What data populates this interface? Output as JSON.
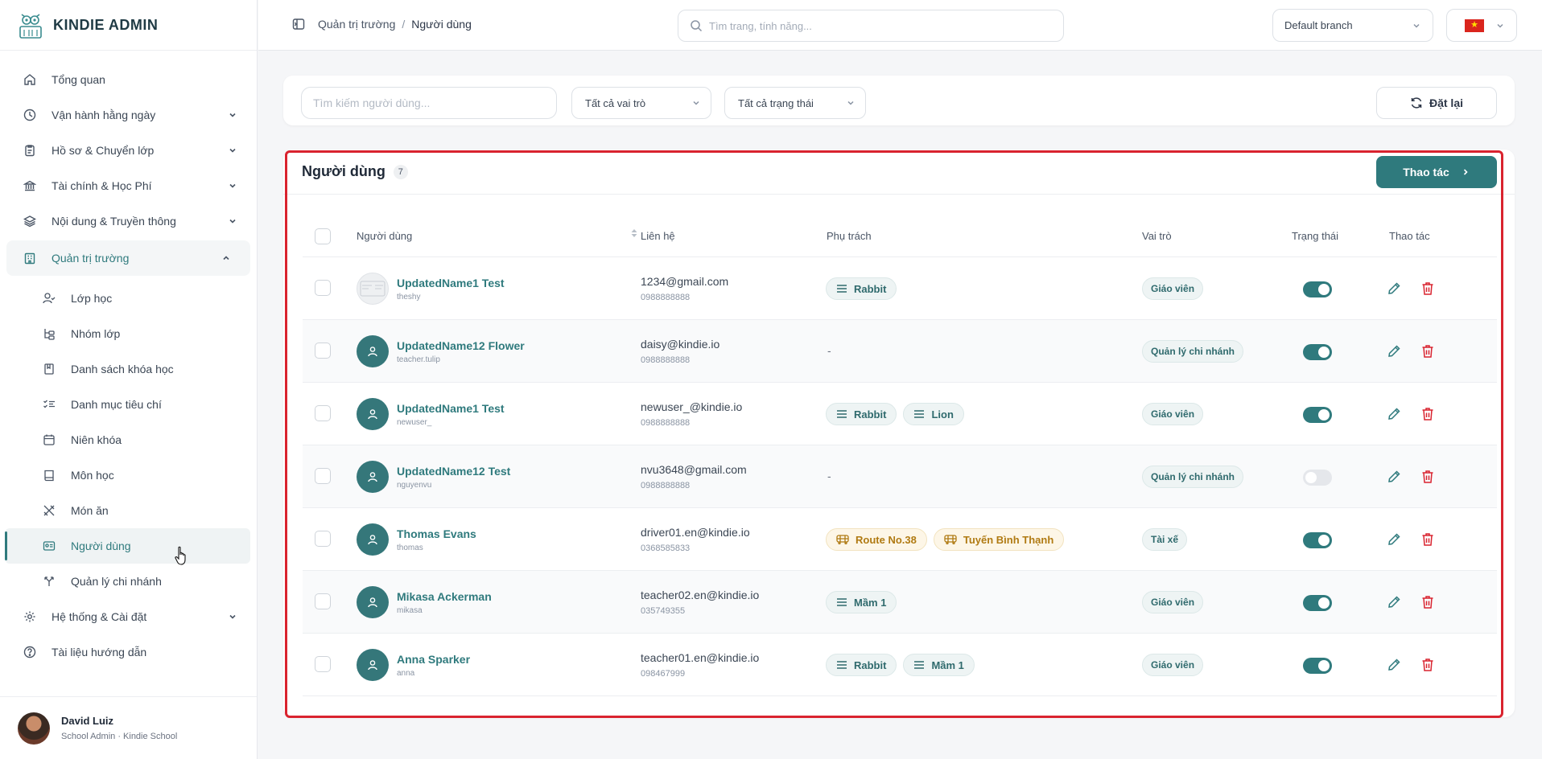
{
  "brand": {
    "name": "KINDIE ADMIN"
  },
  "sidebar": {
    "items": [
      {
        "label": "Tổng quan",
        "icon": "home-icon"
      },
      {
        "label": "Vận hành hằng ngày",
        "icon": "clock-icon"
      },
      {
        "label": "Hồ sơ & Chuyển lớp",
        "icon": "clipboard-icon"
      },
      {
        "label": "Tài chính & Học Phí",
        "icon": "bank-icon"
      },
      {
        "label": "Nội dung & Truyền thông",
        "icon": "layers-icon"
      },
      {
        "label": "Quản trị trường",
        "icon": "building-icon"
      }
    ],
    "subitems": [
      {
        "label": "Lớp học",
        "icon": "user-check-icon"
      },
      {
        "label": "Nhóm lớp",
        "icon": "group-tree-icon"
      },
      {
        "label": "Danh sách khóa học",
        "icon": "book-bookmark-icon"
      },
      {
        "label": "Danh mục tiêu chí",
        "icon": "checklist-icon"
      },
      {
        "label": "Niên khóa",
        "icon": "calendar-icon"
      },
      {
        "label": "Môn học",
        "icon": "book-icon"
      },
      {
        "label": "Món ăn",
        "icon": "utensils-icon"
      },
      {
        "label": "Người dùng",
        "icon": "id-card-icon"
      },
      {
        "label": "Quản lý chi nhánh",
        "icon": "branch-icon"
      }
    ],
    "bottom_items": [
      {
        "label": "Hệ thống & Cài đặt",
        "icon": "gear-icon"
      },
      {
        "label": "Tài liệu hướng dẫn",
        "icon": "help-icon"
      }
    ],
    "user": {
      "name": "David Luiz",
      "role": "School Admin · Kindie School"
    }
  },
  "topbar": {
    "breadcrumb": [
      "Quản trị trường",
      "Người dùng"
    ],
    "breadcrumb_sep": "/",
    "search_placeholder": "Tìm trang, tính năng...",
    "branch": "Default branch",
    "lang_flag": "★"
  },
  "filters": {
    "search_placeholder": "Tìm kiếm người dùng...",
    "role": "Tất cả vai trò",
    "status": "Tất cả trạng thái",
    "reset_label": "Đặt lại"
  },
  "table": {
    "title": "Người dùng",
    "count": "7",
    "action_label": "Thao tác",
    "columns": [
      "Người dùng",
      "Liên hệ",
      "Phụ trách",
      "Vai trò",
      "Trạng thái",
      "Thao tác"
    ],
    "rows": [
      {
        "name": "UpdatedName1 Test",
        "handle": "theshy",
        "email": "1234@gmail.com",
        "phone": "0988888888",
        "tags": [
          "Rabbit"
        ],
        "tag_type": "class",
        "role": "Giáo viên",
        "active": true,
        "avatar": "image"
      },
      {
        "name": "UpdatedName12 Flower",
        "handle": "teacher.tulip",
        "email": "daisy@kindie.io",
        "phone": "0988888888",
        "tags": [],
        "empty": "-",
        "role": "Quản lý chi nhánh",
        "active": true,
        "avatar": "default"
      },
      {
        "name": "UpdatedName1 Test",
        "handle": "newuser_",
        "email": "newuser_@kindie.io",
        "phone": "0988888888",
        "tags": [
          "Rabbit",
          "Lion"
        ],
        "tag_type": "class",
        "role": "Giáo viên",
        "active": true,
        "avatar": "default"
      },
      {
        "name": "UpdatedName12 Test",
        "handle": "nguyenvu",
        "email": "nvu3648@gmail.com",
        "phone": "0988888888",
        "tags": [],
        "empty": "-",
        "role": "Quản lý chi nhánh",
        "active": false,
        "avatar": "default"
      },
      {
        "name": "Thomas Evans",
        "handle": "thomas",
        "email": "driver01.en@kindie.io",
        "phone": "0368585833",
        "tags": [
          "Route No.38",
          "Tuyến Bình Thạnh"
        ],
        "tag_type": "bus",
        "role": "Tài xế",
        "active": true,
        "avatar": "default"
      },
      {
        "name": "Mikasa Ackerman",
        "handle": "mikasa",
        "email": "teacher02.en@kindie.io",
        "phone": "035749355",
        "tags": [
          "Mầm 1"
        ],
        "tag_type": "class",
        "role": "Giáo viên",
        "active": true,
        "avatar": "default"
      },
      {
        "name": "Anna Sparker",
        "handle": "anna",
        "email": "teacher01.en@kindie.io",
        "phone": "098467999",
        "tags": [
          "Rabbit",
          "Mầm 1"
        ],
        "tag_type": "class",
        "role": "Giáo viên",
        "active": true,
        "avatar": "default"
      }
    ]
  },
  "colors": {
    "accent": "#2f7a7d",
    "danger": "#d9232f",
    "bus_tag": "#b07a12"
  }
}
